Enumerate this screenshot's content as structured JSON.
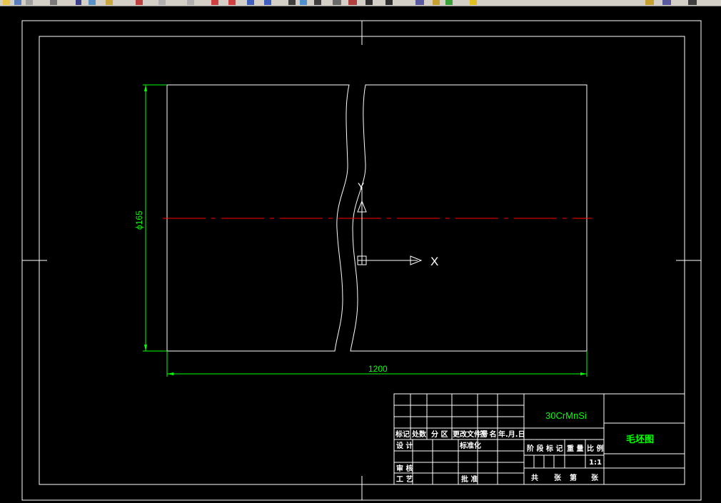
{
  "app": {
    "toolbar_icons": [
      "open-icon",
      "save-icon",
      "print-icon",
      "plot-icon",
      "cut-icon",
      "copy-icon",
      "paste-icon",
      "match-icon",
      "undo-icon",
      "redo-icon",
      "pan-icon",
      "zoom-realtime-icon",
      "zoom-window-icon",
      "zoom-previous-icon",
      "properties-icon",
      "design-center-icon",
      "tool-palette-icon",
      "sheet-set-icon",
      "markup-icon",
      "calculator-icon",
      "help-icon",
      "layer-icon",
      "layer-state-icon",
      "layer-previous-icon",
      "light-icon",
      "freeze-icon",
      "color-icon",
      "linetype-icon"
    ]
  },
  "drawing": {
    "dimension_diameter": "ϕ165",
    "dimension_length": "1200",
    "ucs_x_label": "X",
    "ucs_y_label": "Y",
    "colors": {
      "geometry": "#ffffff",
      "dimension": "#00ff00",
      "centerline": "#ff0000",
      "background": "#000000"
    }
  },
  "title_block": {
    "material": "30CrMnSi",
    "drawing_name": "毛坯图",
    "scale": "1:1",
    "header_labels": [
      "标记",
      "处数",
      "分 区",
      "更改文件号",
      "签 名",
      "年.月.日"
    ],
    "row_design": "设 计",
    "row_standard": "标准化",
    "row_review": "审 核",
    "row_process": "工 艺",
    "row_approve": "批 准",
    "stage_mark": "阶 段 标 记",
    "weight": "重 量",
    "ratio": "比 例",
    "total_sheets": "共",
    "sheets_word": "张",
    "page_of": "第",
    "sheet_word2": "张"
  }
}
